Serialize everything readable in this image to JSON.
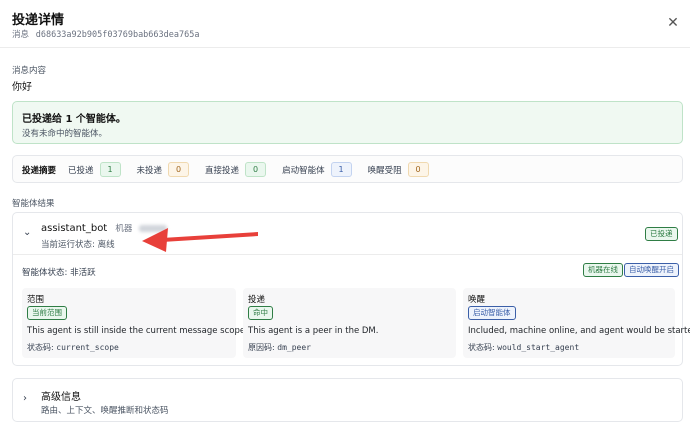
{
  "header": {
    "title": "投递详情",
    "subtitle_label": "消息",
    "message_id": "d68633a92b905f03769bab663dea765a",
    "close_icon": "close-icon"
  },
  "message": {
    "label": "消息内容",
    "content": "你好"
  },
  "delivery_notice": {
    "heading": "已投递给 1 个智能体。",
    "detail": "没有未命中的智能体。",
    "accent_color": "#2f7d45"
  },
  "summary": {
    "label": "投递摘要",
    "items": [
      {
        "key": "已投递",
        "value": "1",
        "tone": "green"
      },
      {
        "key": "未投递",
        "value": "0",
        "tone": "orange"
      },
      {
        "key": "直接投递",
        "value": "0",
        "tone": "green"
      },
      {
        "key": "启动智能体",
        "value": "1",
        "tone": "blue"
      },
      {
        "key": "唤醒受阻",
        "value": "0",
        "tone": "orange"
      }
    ]
  },
  "agent_results": {
    "label": "智能体结果",
    "agent": {
      "name": "assistant_bot",
      "machine_label": "机器",
      "runtime_state": "当前运行状态: 离线",
      "delivered_badge": "已投递",
      "agent_status": "智能体状态: 非活跃",
      "machine_online_badge": "机器在线",
      "auto_wake_badge": "自动唤醒开启",
      "columns": [
        {
          "title": "范围",
          "badge": "当前范围",
          "badge_tone": "green",
          "description": "This agent is still inside the current message scope.",
          "code_label": "状态码:",
          "code": "current_scope"
        },
        {
          "title": "投递",
          "badge": "命中",
          "badge_tone": "green",
          "description": "This agent is a peer in the DM.",
          "code_label": "原因码:",
          "code": "dm_peer"
        },
        {
          "title": "唤醒",
          "badge": "启动智能体",
          "badge_tone": "blue",
          "description": "Included, machine online, and agent would be started.",
          "code_label": "状态码:",
          "code": "would_start_agent"
        }
      ]
    }
  },
  "advanced": {
    "title": "高级信息",
    "subtitle": "路由、上下文、唤醒推断和状态码"
  },
  "annotation": {
    "arrow_color": "#e8403a"
  }
}
